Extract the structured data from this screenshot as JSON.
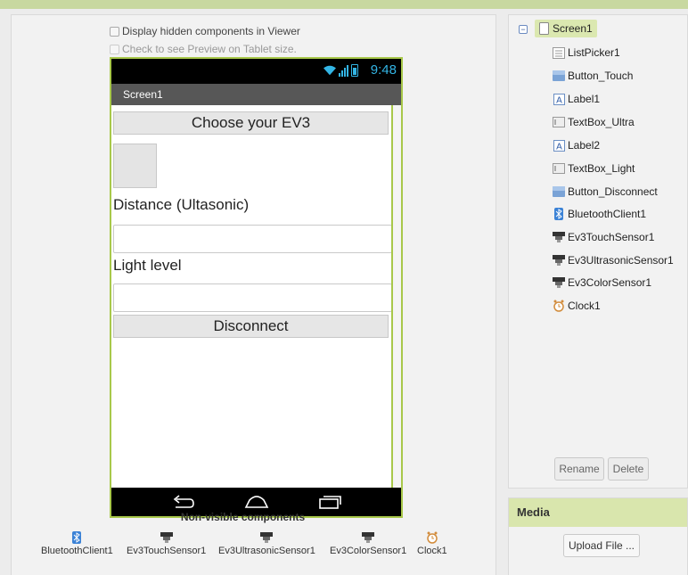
{
  "viewer": {
    "display_hidden_label": "Display hidden components in Viewer",
    "tablet_preview_label": "Check to see Preview on Tablet size.",
    "status_time": "9:48",
    "screen_title": "Screen1",
    "choose_button": "Choose your EV3",
    "distance_label": "Distance (Ultasonic)",
    "light_label": "Light level",
    "disconnect_button": "Disconnect"
  },
  "non_visible": {
    "title": "Non-visible components",
    "items": [
      {
        "label": "BluetoothClient1",
        "icon": "bluetooth-icon"
      },
      {
        "label": "Ev3TouchSensor1",
        "icon": "ev3-sensor-icon"
      },
      {
        "label": "Ev3UltrasonicSensor1",
        "icon": "ev3-sensor-icon"
      },
      {
        "label": "Ev3ColorSensor1",
        "icon": "ev3-sensor-icon"
      },
      {
        "label": "Clock1",
        "icon": "clock-icon"
      }
    ]
  },
  "components": {
    "root": "Screen1",
    "items": [
      {
        "label": "ListPicker1",
        "icon": "listpicker-icon"
      },
      {
        "label": "Button_Touch",
        "icon": "button-icon"
      },
      {
        "label": "Label1",
        "icon": "label-icon"
      },
      {
        "label": "TextBox_Ultra",
        "icon": "textbox-icon"
      },
      {
        "label": "Label2",
        "icon": "label-icon"
      },
      {
        "label": "TextBox_Light",
        "icon": "textbox-icon"
      },
      {
        "label": "Button_Disconnect",
        "icon": "button-icon"
      },
      {
        "label": "BluetoothClient1",
        "icon": "bluetooth-icon"
      },
      {
        "label": "Ev3TouchSensor1",
        "icon": "ev3-sensor-icon"
      },
      {
        "label": "Ev3UltrasonicSensor1",
        "icon": "ev3-sensor-icon"
      },
      {
        "label": "Ev3ColorSensor1",
        "icon": "ev3-sensor-icon"
      },
      {
        "label": "Clock1",
        "icon": "clock-icon"
      }
    ],
    "rename_button": "Rename",
    "delete_button": "Delete"
  },
  "media": {
    "title": "Media",
    "upload_button": "Upload File ..."
  },
  "colors": {
    "accent_green": "#a8c84a",
    "status_blue": "#33b5e5"
  }
}
